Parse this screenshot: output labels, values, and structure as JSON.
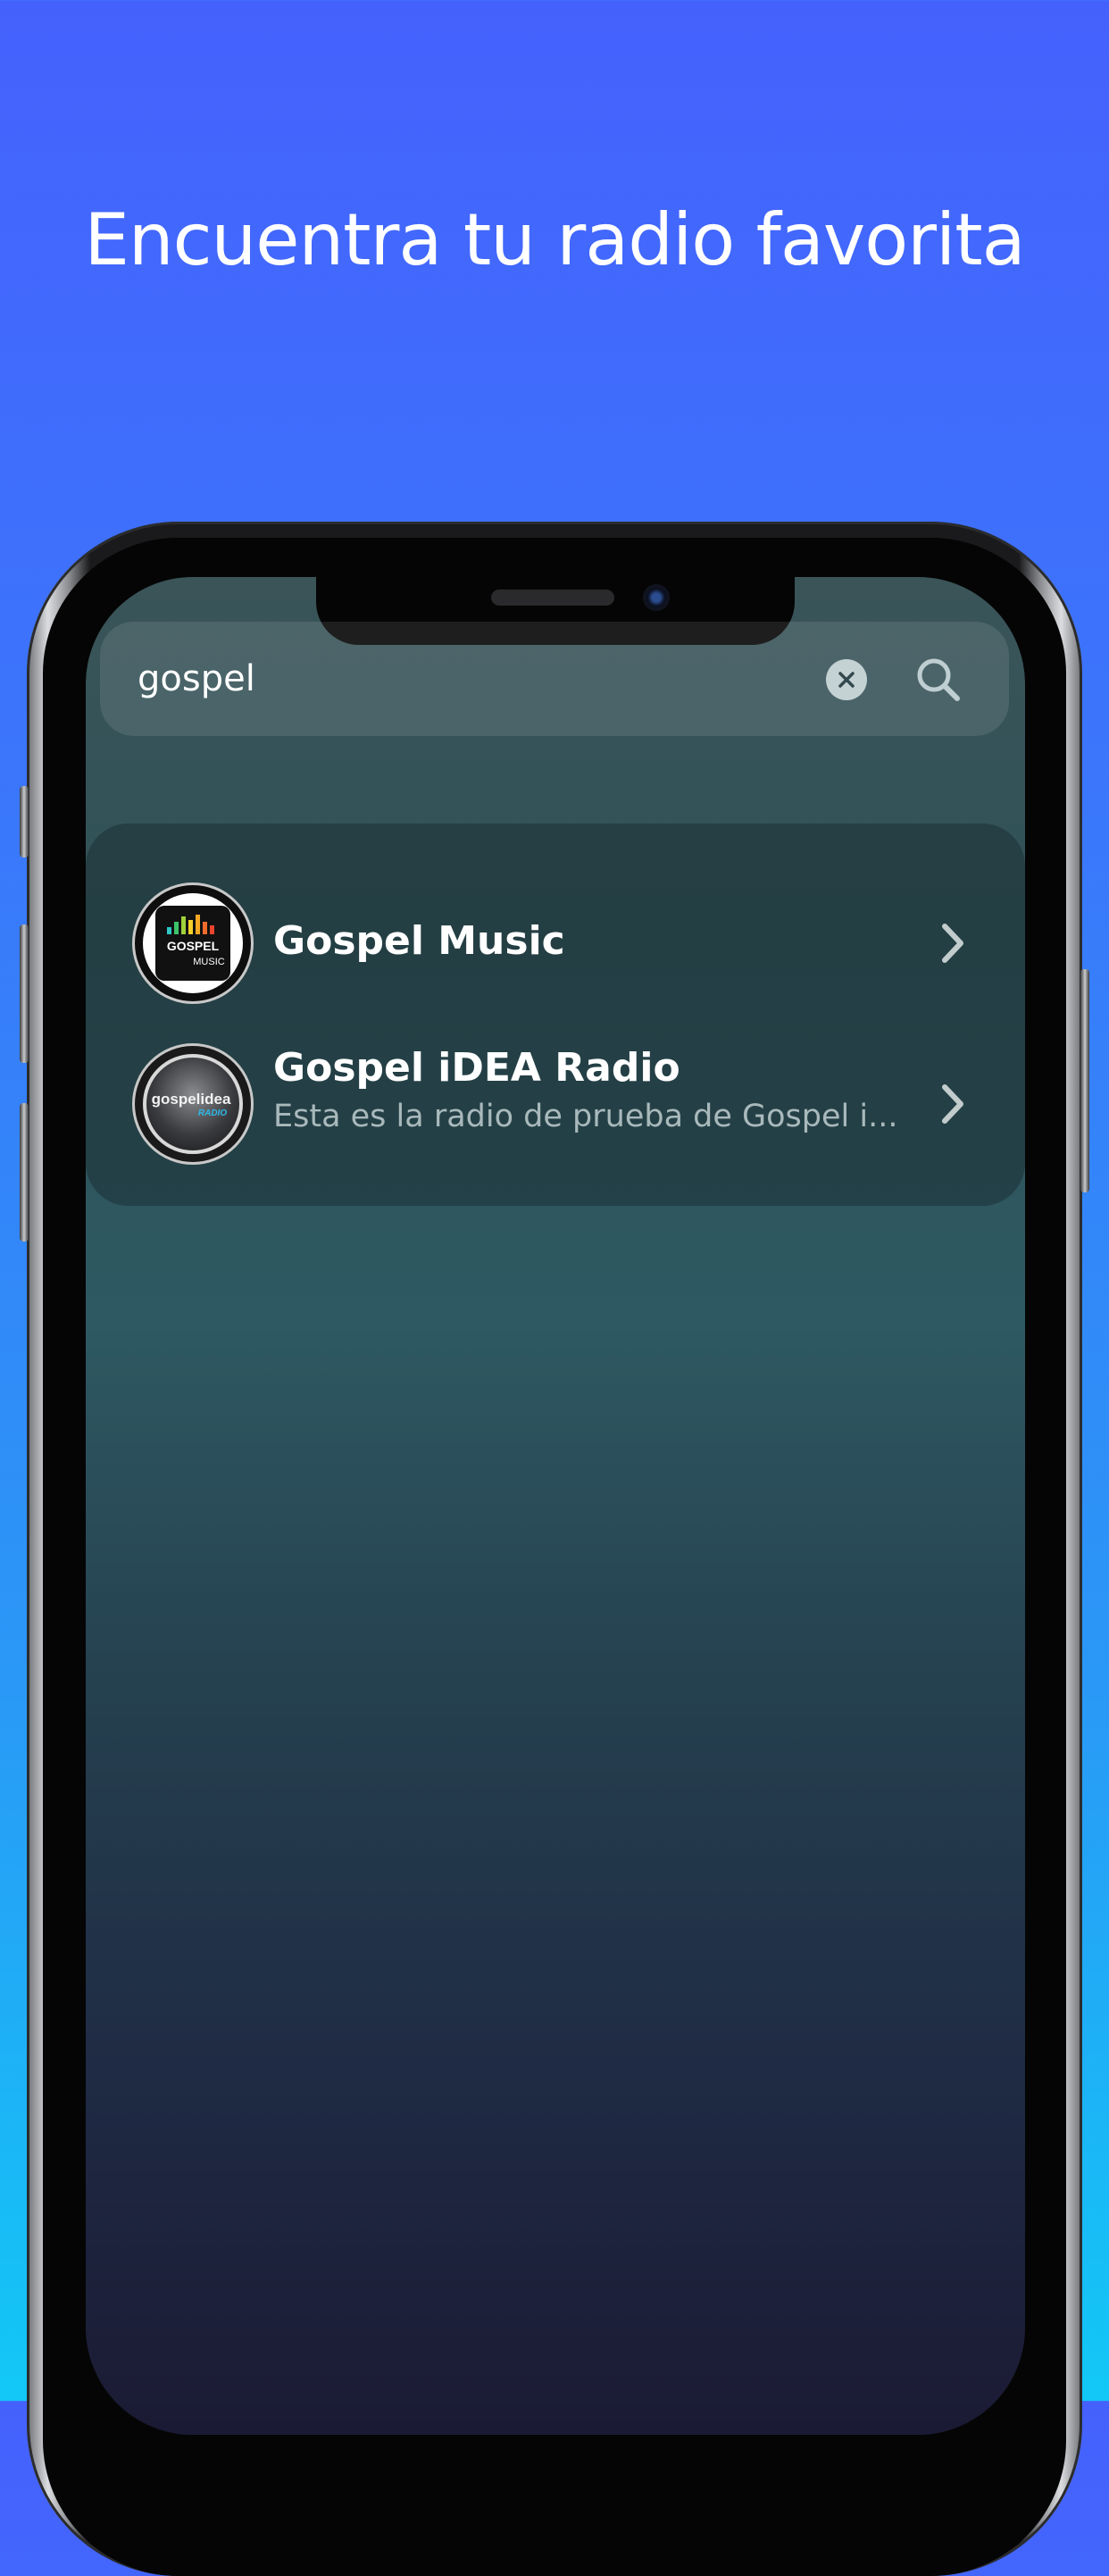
{
  "headline": "Encuentra tu radio favorita",
  "search": {
    "value": "gospel",
    "clear_icon": "clear-x-icon",
    "search_icon": "magnifier-icon"
  },
  "results": [
    {
      "title": "Gospel Music",
      "subtitle": "",
      "logo_text_top": "GOSPEL",
      "logo_text_bottom": "MUSIC",
      "chevron_icon": "chevron-right-icon"
    },
    {
      "title": "Gospel iDEA Radio",
      "subtitle": "Esta es la radio de prueba de Gospel i...",
      "logo_text_top": "gospelidea",
      "logo_text_bottom": "RADIO",
      "chevron_icon": "chevron-right-icon"
    }
  ],
  "colors": {
    "background_top": "#4561fd",
    "background_bottom": "#12c8f6",
    "screen_top": "#3a5458",
    "screen_bottom": "#1b1a34"
  }
}
